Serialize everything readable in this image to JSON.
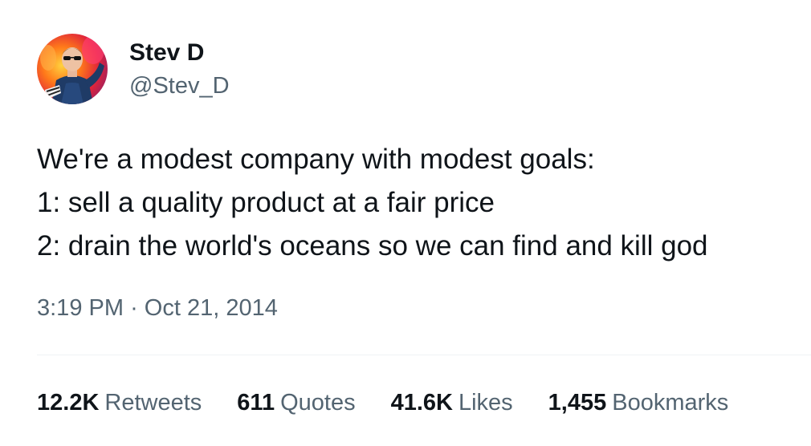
{
  "author": {
    "display_name": "Stev D",
    "handle": "@Stev_D",
    "avatar_icon": "profile-photo"
  },
  "tweet": {
    "lines": [
      "We're a modest company with modest goals:",
      "1: sell a quality product at a fair price",
      "2: drain the world's oceans so we can find and kill god"
    ],
    "time": "3:19 PM",
    "separator": "·",
    "date": "Oct 21, 2014"
  },
  "stats": {
    "retweets": {
      "value": "12.2K",
      "label": "Retweets"
    },
    "quotes": {
      "value": "611",
      "label": "Quotes"
    },
    "likes": {
      "value": "41.6K",
      "label": "Likes"
    },
    "bookmarks": {
      "value": "1,455",
      "label": "Bookmarks"
    }
  },
  "colors": {
    "text_primary": "#0f1419",
    "text_secondary": "#536471",
    "divider": "#eff3f4",
    "background": "#ffffff"
  }
}
